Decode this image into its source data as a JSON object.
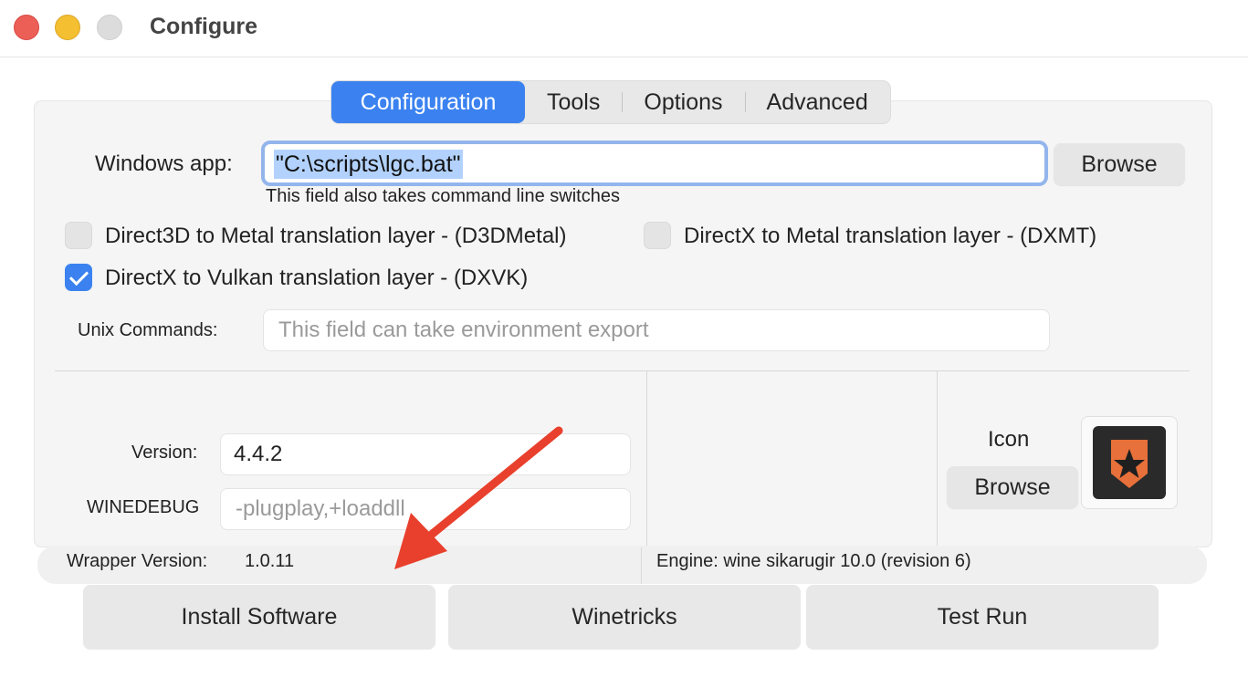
{
  "window": {
    "title": "Configure"
  },
  "tabs": [
    {
      "label": "Configuration",
      "active": true
    },
    {
      "label": "Tools",
      "active": false
    },
    {
      "label": "Options",
      "active": false
    },
    {
      "label": "Advanced",
      "active": false
    }
  ],
  "config": {
    "windows_app_label": "Windows app:",
    "windows_app_value": "\"C:\\scripts\\lgc.bat\"",
    "browse_label": "Browse",
    "hint": "This field also takes command line switches",
    "checkboxes": [
      {
        "label": "Direct3D to Metal translation layer - (D3DMetal)",
        "checked": false
      },
      {
        "label": "DirectX to Metal translation layer - (DXMT)",
        "checked": false
      },
      {
        "label": "DirectX to Vulkan translation layer - (DXVK)",
        "checked": true
      }
    ],
    "unix_label": "Unix Commands:",
    "unix_placeholder": "This field can take environment export",
    "version_label": "Version:",
    "version_value": "4.4.2",
    "winedebug_label": "WINEDEBUG",
    "winedebug_placeholder": "-plugplay,+loaddll",
    "icon_label": "Icon",
    "icon_browse_label": "Browse"
  },
  "status": {
    "wrapper_label": "Wrapper Version:",
    "wrapper_value": "1.0.11",
    "engine_text": "Engine: wine sikarugir 10.0 (revision 6)"
  },
  "actions": {
    "install": "Install Software",
    "winetricks": "Winetricks",
    "test_run": "Test Run"
  },
  "colors": {
    "accent": "#3b82f0",
    "close": "#ec5f57",
    "minimize": "#f4bf30",
    "annotation_arrow": "#e8402c",
    "icon_badge": "#e8703a"
  }
}
